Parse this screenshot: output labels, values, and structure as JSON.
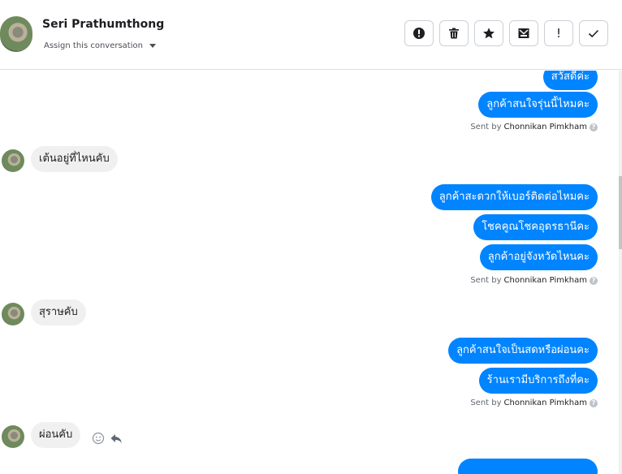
{
  "header": {
    "contact_name": "Seri Prathumthong",
    "assign_label": "Assign this conversation",
    "toolbar_icons": [
      "alert-icon",
      "trash-icon",
      "star-icon",
      "inbox-icon",
      "exclamation-icon",
      "check-icon"
    ],
    "exclamation_glyph": "!"
  },
  "messages": {
    "m1": "สวัสดีค่ะ",
    "m2": "ลูกค้าสนใจรุ่นนี้ไหมคะ",
    "m3": "เต้นอยู่ที่ไหนคับ",
    "m4": "ลูกค้าสะดวกให้เบอร์ติดต่อไหมคะ",
    "m5": "โชคคูณโชคอุดรธานีคะ",
    "m6": "ลูกค้าอยู่จังหวัดไหนคะ",
    "m7": "สุราษคับ",
    "m8": "ลูกค้าสนใจเป็นสดหรือผ่อนคะ",
    "m9": "ร้านเรามีบริการถึงที่คะ",
    "m10": "ผ่อนคับ"
  },
  "sent_by": {
    "prefix": "Sent by",
    "agent": "Chonnikan Pimkham",
    "info": "?"
  },
  "colors": {
    "outgoing_bubble": "#0084ff",
    "incoming_bubble": "#f1f0f0"
  }
}
